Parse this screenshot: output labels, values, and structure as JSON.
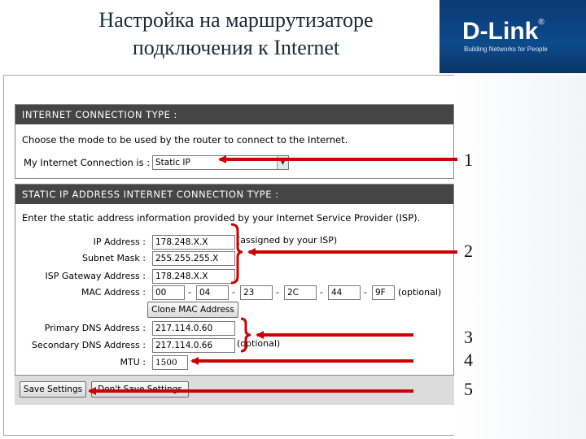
{
  "slide": {
    "title_line1": "Настройка на маршрутизаторе",
    "title_line2": "подключения к Internet",
    "logo_text": "D-Link",
    "logo_reg": "®",
    "logo_tagline": "Building Networks for People"
  },
  "internet_connection": {
    "heading": "INTERNET CONNECTION TYPE :",
    "description": "Choose the mode to be used by the router to connect to the Internet.",
    "connection_label": "My Internet Connection is :",
    "connection_value": "Static IP"
  },
  "static_ip": {
    "heading": "STATIC IP ADDRESS INTERNET CONNECTION TYPE :",
    "description": "Enter the static address information provided by your Internet Service Provider (ISP).",
    "ip_label": "IP Address :",
    "ip_value": "178.248.X.X",
    "ip_note": "(assigned by your ISP)",
    "subnet_label": "Subnet Mask :",
    "subnet_value": "255.255.255.X",
    "gateway_label": "ISP Gateway Address :",
    "gateway_value": "178.248.X.X",
    "mac_label": "MAC Address :",
    "mac_octets": [
      "00",
      "04",
      "23",
      "2C",
      "44",
      "9F"
    ],
    "mac_sep": "-",
    "mac_note": "(optional)",
    "clone_button": "Clone MAC Address",
    "dns1_label": "Primary DNS Address :",
    "dns1_value": "217.114.0.60",
    "dns2_label": "Secondary DNS Address :",
    "dns2_value": "217.114.0.66",
    "dns2_note": "(optional)",
    "mtu_label": "MTU :",
    "mtu_value": "1500"
  },
  "actions": {
    "save_label": "Save Settings",
    "dont_save_label": "Don't Save Settings"
  },
  "annotations": {
    "n1": "1",
    "n2": "2",
    "n3": "3",
    "n4": "4",
    "n5": "5"
  },
  "colors": {
    "arrow": "#cc0000",
    "panel_header": "#454545",
    "header_band": "#0d4a8c"
  }
}
